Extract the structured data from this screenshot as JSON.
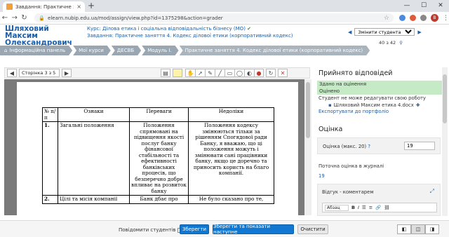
{
  "browser": {
    "tab_title": "Завдання: Практичне заняття 4.",
    "tab_close": "×",
    "new_tab": "+",
    "url": "elearn.nubip.edu.ua/mod/assign/view.php?id=1375298&action=grader",
    "win_min": "—",
    "win_max": "☐",
    "win_close": "✕",
    "avatar_letter": "B"
  },
  "header": {
    "user_name": "Шляховий Максим Олександрович",
    "course_label": "Курс: Ділова етика і соціальна відповідальність бізнесу (МО)",
    "assignment_label": "Завдання: Практичне заняття 4. Кодекс ділової етики (корпоративний кодекс)",
    "prev_arrow": "◀",
    "next_arrow": "▶",
    "change_user": "Змінити студента",
    "more": "⋯",
    "count": "40 з 42",
    "count_icon": "⚲"
  },
  "breadcrumb": [
    "Інформаційна панель",
    "Мої курси",
    "ДЕСВБ",
    "Модуль І.",
    "Практичне заняття 4. Кодекс ділової етики (корпоративний кодекс)"
  ],
  "pdf_toolbar": {
    "prev": "◀",
    "page_label": "Сторінка 3 з 5",
    "next": "▶"
  },
  "doc_table": {
    "headers": [
      "№ п/п",
      "Ознаки",
      "Переваги",
      "Недоліки"
    ],
    "rows": [
      {
        "num": "1.",
        "feature": "Загальні положення",
        "pros": "Положення спрямовані на підвищення якості послуг банку фінансової стабільності та ефективності банківських процесів, що безперечно добре впливає на розвиток банку",
        "cons": "Положення кодексу змінюються тільки за рішенням Спогядової ради Банку, я вважаю, що ці положення можуть і змінювати сані працівники банку, якщо це доречно та приносить користь на благо компанії."
      },
      {
        "num": "2.",
        "feature": "Цілі та місія компанії",
        "pros": "Банк дбає про",
        "cons": "Не було сказано про те,"
      }
    ]
  },
  "right_panel": {
    "title": "Прийнято відповідей",
    "status_submitted": "Здано на оцінення",
    "status_graded": "Оцінено",
    "no_edit": "Студент не може редагувати свою роботу",
    "file_name": "Шляховий Максим етика 4.docx",
    "file_add": "✚",
    "export": "Експортувати до портфоліо",
    "grade_title": "Оцінка",
    "grade_label": "Оцінка (макс. 20)",
    "grade_help": "?",
    "grade_value": "19",
    "current_label": "Поточна оцінка в журналі",
    "current_value": "19",
    "feedback_label": "Відгук - коментарем",
    "editor_format": "Абзац",
    "editor_bold": "B",
    "editor_italic": "I",
    "editor_list1": "☰",
    "editor_list2": "≡",
    "editor_link": "🔗",
    "editor_unlink": "⛓"
  },
  "bottom": {
    "notify_label": "Повідомити студентів",
    "save": "Зберегти",
    "save_next": "Зберегти та показати наступне",
    "reset": "Очистити"
  }
}
